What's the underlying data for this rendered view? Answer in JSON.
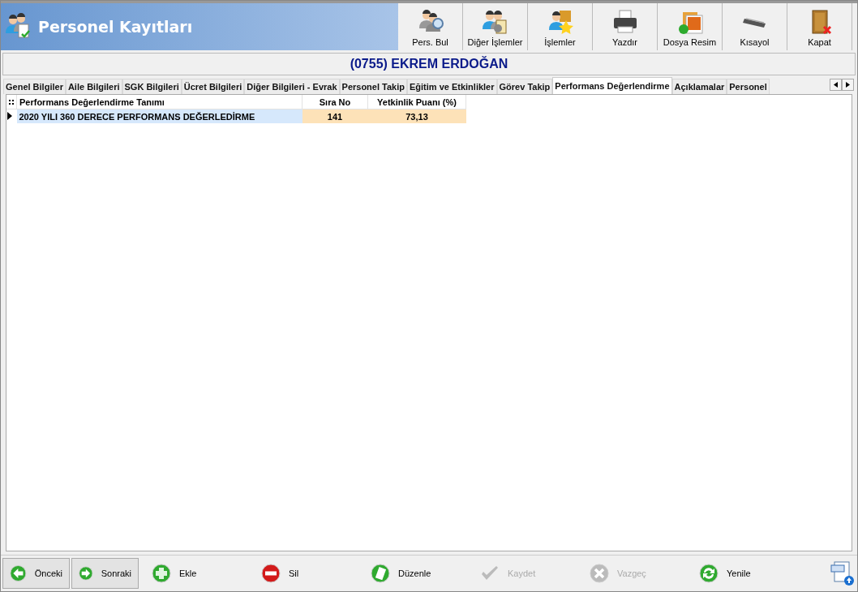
{
  "window": {
    "title": "Personel Kayıtları"
  },
  "toolbar": [
    {
      "label": "Pers. Bul",
      "kind": "find"
    },
    {
      "label": "Diğer İşlemler",
      "kind": "process"
    },
    {
      "label": "İşlemler",
      "kind": "star"
    },
    {
      "label": "Yazdır",
      "kind": "print"
    },
    {
      "label": "Dosya Resim",
      "kind": "image"
    },
    {
      "label": "Kısayol",
      "kind": "keyboard"
    },
    {
      "label": "Kapat",
      "kind": "door"
    }
  ],
  "employee": "(0755) EKREM ERDOĞAN",
  "tabs": [
    {
      "label": "Genel Bilgiler",
      "selected": false
    },
    {
      "label": "Aile Bilgileri",
      "selected": false
    },
    {
      "label": "SGK Bilgileri",
      "selected": false
    },
    {
      "label": "Ücret Bilgileri",
      "selected": false
    },
    {
      "label": "Diğer Bilgileri - Evrak",
      "selected": false
    },
    {
      "label": "Personel Takip",
      "selected": false
    },
    {
      "label": "Eğitim ve Etkinlikler",
      "selected": false
    },
    {
      "label": "Görev Takip",
      "selected": false
    },
    {
      "label": "Performans Değerlendirme",
      "selected": true
    },
    {
      "label": "Açıklamalar",
      "selected": false
    },
    {
      "label": "Personel",
      "selected": false
    }
  ],
  "table": {
    "columns": [
      "Performans Değerlendirme Tanımı",
      "Sıra No",
      "Yetkinlik Puanı (%)"
    ],
    "rows": [
      {
        "cells": [
          "2020 YILI 360 DERECE PERFORMANS DEĞERLEDİRME",
          "141",
          "73,13"
        ],
        "selected": true
      }
    ]
  },
  "bottom_bar": [
    {
      "label": "Önceki",
      "kind": "back",
      "disabled": false
    },
    {
      "label": "Sonraki",
      "kind": "forward",
      "disabled": false
    },
    {
      "label": "Ekle",
      "kind": "add",
      "disabled": false
    },
    {
      "label": "Sil",
      "kind": "remove",
      "disabled": false
    },
    {
      "label": "Düzenle",
      "kind": "edit",
      "disabled": false
    },
    {
      "label": "Kaydet",
      "kind": "save",
      "disabled": true
    },
    {
      "label": "Vazgeç",
      "kind": "cancel",
      "disabled": true
    },
    {
      "label": "Yenile",
      "kind": "refresh",
      "disabled": false
    }
  ]
}
